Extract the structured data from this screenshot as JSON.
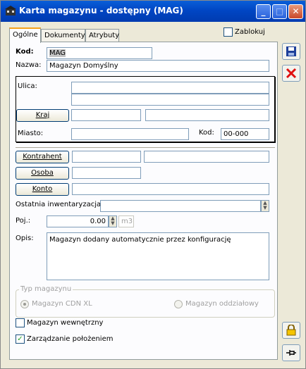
{
  "window": {
    "title": "Karta magazynu - dostępny (MAG)",
    "accent": "#0054e3"
  },
  "tabs": [
    {
      "label": "Ogólne",
      "active": true
    },
    {
      "label": "Dokumenty",
      "active": false
    },
    {
      "label": "Atrybuty",
      "active": false
    }
  ],
  "block_label": "Zablokuj",
  "form": {
    "kod_label": "Kod:",
    "kod_value": "MAG",
    "nazwa_label": "Nazwa:",
    "nazwa_value": "Magazyn Domyślny"
  },
  "address": {
    "ulica_label": "Ulica:",
    "ulica1": "",
    "ulica2": "",
    "kraj_button": "Kraj",
    "kraj_value": "",
    "kraj_name": "",
    "miasto_label": "Miasto:",
    "miasto_value": "",
    "kod_label": "Kod:",
    "kod_value": "00-000"
  },
  "links": {
    "kontrahent_button": "Kontrahent",
    "kontrahent_code": "",
    "kontrahent_name": "",
    "osoba_button": "Osoba",
    "osoba_value": "",
    "konto_button": "Konto",
    "konto_value": ""
  },
  "inventory": {
    "label": "Ostatnia inwentaryzacja:",
    "value": ""
  },
  "capacity": {
    "label": "Poj.:",
    "value": "0.00",
    "unit": "m3"
  },
  "description": {
    "label": "Opis:",
    "value": "Magazyn dodany automatycznie przez konfigurację"
  },
  "type": {
    "legend": "Typ magazynu",
    "option1": "Magazyn CDN XL",
    "option2": "Magazyn oddziałowy",
    "selected": "Magazyn CDN XL"
  },
  "options": {
    "internal_label": "Magazyn wewnętrzny",
    "internal_checked": false,
    "location_label": "Zarządzanie położeniem",
    "location_checked": true
  },
  "side_buttons": {
    "save_icon": "floppy-disk-icon",
    "cancel_icon": "red-x-icon",
    "lock_icon": "padlock-icon",
    "pin_icon": "pin-icon"
  }
}
